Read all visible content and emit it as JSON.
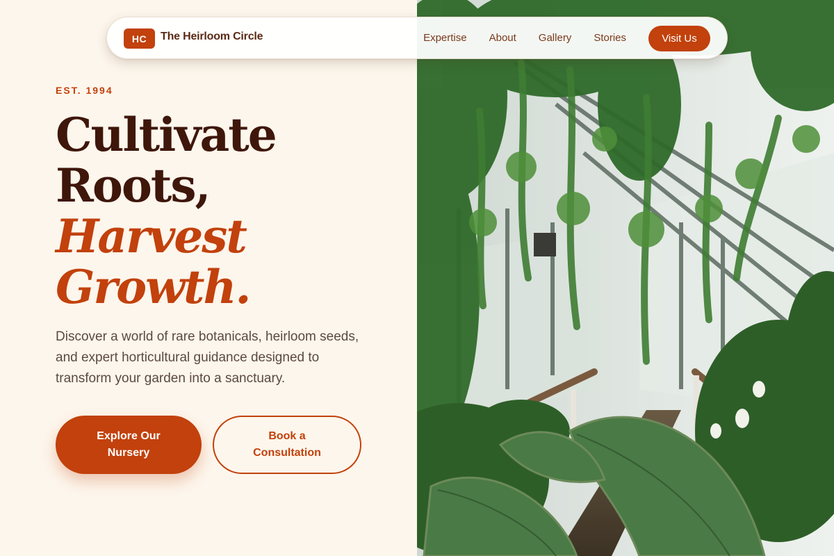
{
  "brand": {
    "badge": "HC",
    "name": "The Heirloom Circle"
  },
  "nav": {
    "links": [
      "Expertise",
      "About",
      "Gallery",
      "Stories"
    ],
    "cta": "Visit Us"
  },
  "hero": {
    "eyebrow": "EST. 1994",
    "headline": [
      "Cultivate",
      "Roots,",
      "Harvest",
      "Growth."
    ],
    "lede": "Discover a world of rare botanicals, heirloom seeds, and expert horticultural guidance designed to transform your garden into a sanctuary.",
    "primary_cta": "Explore Our Nursery",
    "secondary_cta": "Book a Consultation",
    "image_icon": "greenhouse-photo"
  },
  "colors": {
    "accent": "#c2410c",
    "headline_dark": "#3f160a",
    "background": "#fdf6ec",
    "body_text": "#5b4a40"
  }
}
